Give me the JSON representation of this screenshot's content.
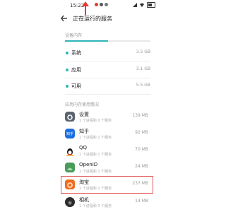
{
  "status": {
    "time": "15:22"
  },
  "header": {
    "title": "正在运行的服务"
  },
  "device_memory": {
    "label": "设备内存",
    "usage_fraction": 0.5,
    "rows": [
      {
        "label": "系统",
        "value": "3.5 GB",
        "color": "#2db5b9"
      },
      {
        "label": "应用",
        "value": "3.1 GB",
        "color": "#2db5b9"
      },
      {
        "label": "可用",
        "value": "5.5 GB",
        "color": "#2db5b9"
      }
    ]
  },
  "app_memory": {
    "label": "应用内存使用情况",
    "apps": [
      {
        "name": "设置",
        "sub": "1 个进程和 0 个服务",
        "size": "139 MB",
        "icon": "settings-icon"
      },
      {
        "name": "知乎",
        "sub": "1 个进程和 1 个服务",
        "size": "92 MB",
        "icon": "zhihu-icon",
        "icon_text": "知乎"
      },
      {
        "name": "QQ",
        "sub": "1 个进程和 1 个服务",
        "size": "70 MB",
        "icon": "qq-penguin-icon"
      },
      {
        "name": "OpenID",
        "sub": "1 个进程和 1 个服务",
        "size": "24 MB",
        "icon": "openid-icon"
      },
      {
        "name": "淘宝",
        "sub": "1 个进程和 1 个服务",
        "size": "237 MB",
        "icon": "taobao-icon"
      },
      {
        "name": "相机",
        "sub": "1 个进程和 0 个服务",
        "size": "14 MB",
        "icon": "camera-icon"
      }
    ]
  }
}
